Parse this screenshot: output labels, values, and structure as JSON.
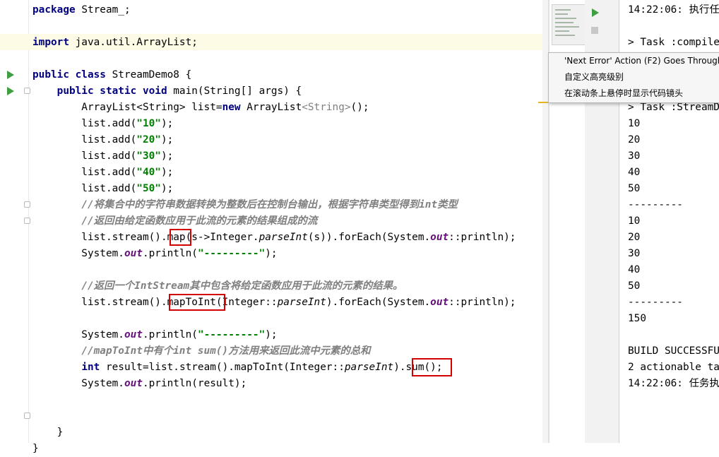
{
  "editor": {
    "lines": [
      [
        {
          "t": "package",
          "c": "kw"
        },
        {
          "t": " Stream_;"
        }
      ],
      [],
      [
        {
          "t": "import",
          "c": "kw"
        },
        {
          "t": " java.util.ArrayList;"
        }
      ],
      [],
      [
        {
          "t": "public class",
          "c": "kw"
        },
        {
          "t": " StreamDemo8 {"
        }
      ],
      [
        {
          "t": "    "
        },
        {
          "t": "public static void",
          "c": "kw"
        },
        {
          "t": " main(String[] args) {"
        }
      ],
      [
        {
          "t": "        ArrayList<String> list="
        },
        {
          "t": "new",
          "c": "kw"
        },
        {
          "t": " ArrayList"
        },
        {
          "t": "<String>",
          "c": "gen"
        },
        {
          "t": "();"
        }
      ],
      [
        {
          "t": "        list.add("
        },
        {
          "t": "\"10\"",
          "c": "str"
        },
        {
          "t": ");"
        }
      ],
      [
        {
          "t": "        list.add("
        },
        {
          "t": "\"20\"",
          "c": "str"
        },
        {
          "t": ");"
        }
      ],
      [
        {
          "t": "        list.add("
        },
        {
          "t": "\"30\"",
          "c": "str"
        },
        {
          "t": ");"
        }
      ],
      [
        {
          "t": "        list.add("
        },
        {
          "t": "\"40\"",
          "c": "str"
        },
        {
          "t": ");"
        }
      ],
      [
        {
          "t": "        list.add("
        },
        {
          "t": "\"50\"",
          "c": "str"
        },
        {
          "t": ");"
        }
      ],
      [
        {
          "t": "        "
        },
        {
          "t": "//将集合中的字符串数据转换为整数后在控制台输出，根据字符串类型得到int类型",
          "c": "cm"
        }
      ],
      [
        {
          "t": "        "
        },
        {
          "t": "//返回由给定函数应用于此流的元素的结果组成的流",
          "c": "cm"
        }
      ],
      [
        {
          "t": "        list.stream().map(s->Integer."
        },
        {
          "t": "parseInt",
          "c": "stat"
        },
        {
          "t": "(s)).forEach(System."
        },
        {
          "t": "out",
          "c": "fld"
        },
        {
          "t": "::println);"
        }
      ],
      [
        {
          "t": "        System."
        },
        {
          "t": "out",
          "c": "fld"
        },
        {
          "t": ".println("
        },
        {
          "t": "\"---------\"",
          "c": "str"
        },
        {
          "t": ");"
        }
      ],
      [],
      [
        {
          "t": "        "
        },
        {
          "t": "//返回一个IntStream其中包含将给定函数应用于此流的元素的结果。",
          "c": "cm"
        }
      ],
      [
        {
          "t": "        list.stream().mapToInt(Integer::"
        },
        {
          "t": "parseInt",
          "c": "stat"
        },
        {
          "t": ").forEach(System."
        },
        {
          "t": "out",
          "c": "fld"
        },
        {
          "t": "::println);"
        }
      ],
      [],
      [
        {
          "t": "        System."
        },
        {
          "t": "out",
          "c": "fld"
        },
        {
          "t": ".println("
        },
        {
          "t": "\"---------\"",
          "c": "str"
        },
        {
          "t": ");"
        }
      ],
      [
        {
          "t": "        "
        },
        {
          "t": "//mapToInt中有个int sum()方法用来返回此流中元素的总和",
          "c": "cm"
        }
      ],
      [
        {
          "t": "        "
        },
        {
          "t": "int",
          "c": "kw"
        },
        {
          "t": " result=list.stream().mapToInt(Integer::"
        },
        {
          "t": "parseInt",
          "c": "stat"
        },
        {
          "t": ").sum();"
        }
      ],
      [
        {
          "t": "        System."
        },
        {
          "t": "out",
          "c": "fld"
        },
        {
          "t": ".println(result);"
        }
      ],
      [],
      [],
      [
        {
          "t": "    }"
        }
      ],
      [
        {
          "t": "}"
        }
      ]
    ]
  },
  "console": {
    "lines": [
      "14:22:06: 执行任",
      "",
      "> Task :compile",
      "",
      "",
      "",
      "> Task :StreamD",
      "10",
      "20",
      "30",
      "40",
      "50",
      "---------",
      "10",
      "20",
      "30",
      "40",
      "50",
      "---------",
      "150",
      "",
      "BUILD SUCCESSFU",
      "2 actionable ta",
      "14:22:06: 任务执"
    ]
  },
  "context_menu": {
    "items": [
      "'Next Error' Action (F2) Goes Through",
      "自定义高亮级别",
      "在滚动条上悬停时显示代码镜头"
    ]
  },
  "colors": {
    "keyword": "#000080",
    "string": "#008000",
    "comment": "#808080",
    "static_field": "#660e7a",
    "highlight_box": "#d40000",
    "run_icon": "#3f9e3f"
  },
  "icons": [
    "run-gutter-icon",
    "fold-icon",
    "run-play-icon",
    "run-stop-icon"
  ]
}
